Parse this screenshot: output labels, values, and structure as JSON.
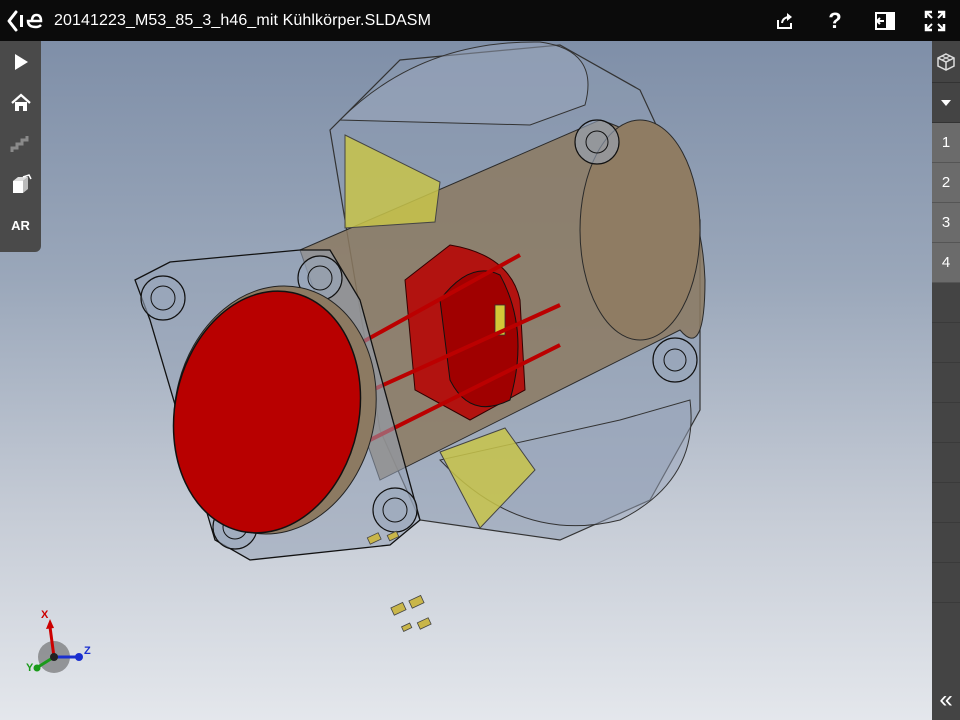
{
  "titlebar": {
    "title": "20141223_M53_85_3_h46_mit Kühlkörper.SLDASM",
    "icons": [
      "back-chevron-icon",
      "edrawings-logo-icon",
      "share-icon",
      "help-icon",
      "panel-toggle-icon",
      "fullscreen-icon"
    ],
    "help_label": "?"
  },
  "left_toolbar": {
    "items": [
      "play-icon",
      "home-icon",
      "steps-icon",
      "box-icon"
    ],
    "ar_label": "AR"
  },
  "right_panel": {
    "configurations": [
      "1",
      "2",
      "3",
      "4"
    ],
    "icons": [
      "cube-icon",
      "triangle-down-icon"
    ],
    "collapse_label": "«"
  },
  "triad": {
    "x_label": "X",
    "y_label": "Y",
    "z_label": "Z"
  },
  "colors": {
    "titlebar_bg": "#0b0b0b",
    "toolbar_bg": "#4a4a4a",
    "model_red": "#b80000",
    "model_yellow": "#c8c44a",
    "model_tan": "#8c7a62"
  }
}
